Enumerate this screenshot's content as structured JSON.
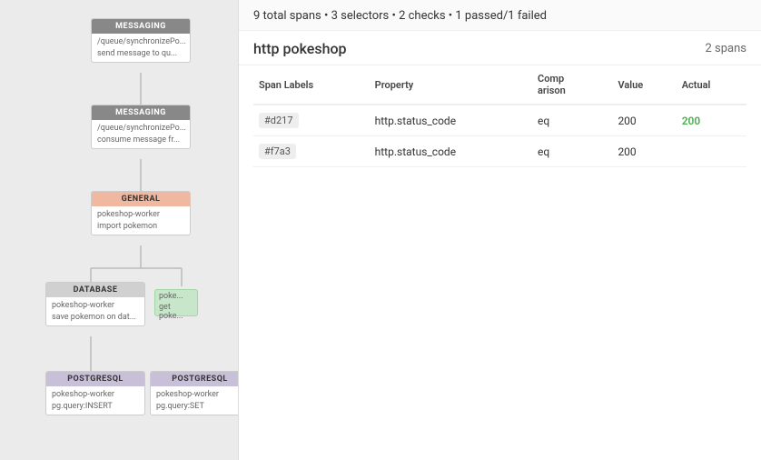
{
  "summary": {
    "text": "9 total spans • 3 selectors • 2 checks • 1 passed/1 failed"
  },
  "section": {
    "title": "http pokeshop",
    "span_count": "2 spans"
  },
  "table": {
    "headers": [
      "Span Labels",
      "Property",
      "Comparison",
      "Value",
      "Actual"
    ],
    "rows": [
      {
        "label": "#d217",
        "property": "http.status_code",
        "comparison": "eq",
        "value": "200",
        "actual": "200",
        "actual_color": "green"
      },
      {
        "label": "#f7a3",
        "property": "http.status_code",
        "comparison": "eq",
        "value": "200",
        "actual": "",
        "actual_color": "none"
      }
    ]
  },
  "nodes": {
    "messaging1": {
      "header": "MESSAGING",
      "line1": "/queue/synchronizePo...",
      "line2": "send message to qu..."
    },
    "messaging2": {
      "header": "MESSAGING",
      "line1": "/queue/synchronizePo...",
      "line2": "consume message fr..."
    },
    "general": {
      "header": "GENERAL",
      "line1": "pokeshop-worker",
      "line2": "import pokemon"
    },
    "database": {
      "header": "DATABASE",
      "line1": "pokeshop-worker",
      "line2": "save pokemon on dat..."
    },
    "postgresql1": {
      "header": "POSTGRESQL",
      "line1": "pokeshop-worker",
      "line2": "pg.query:INSERT"
    },
    "postgresql2": {
      "header": "POSTGRESQL",
      "line1": "pokeshop-worker",
      "line2": "pg.query:SET"
    }
  }
}
